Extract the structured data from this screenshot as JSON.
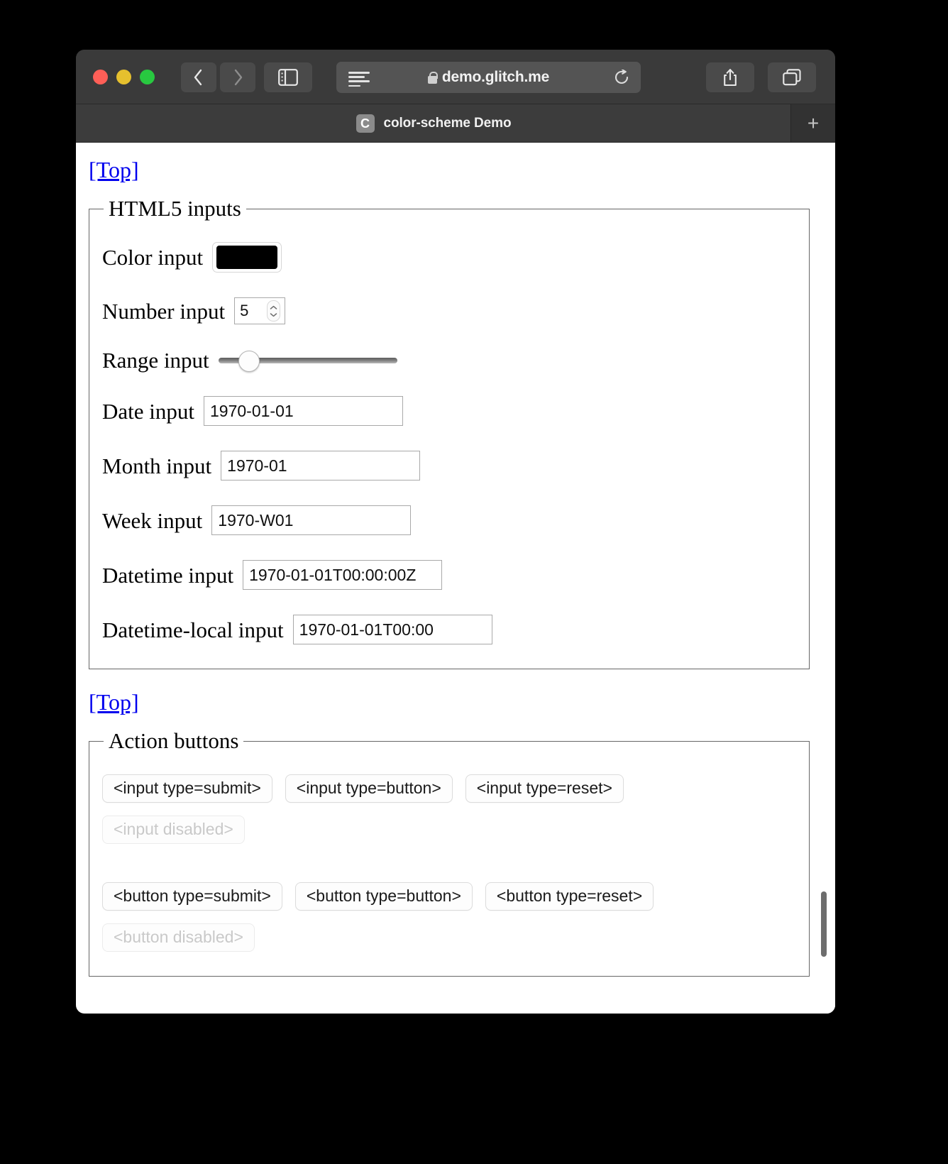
{
  "browser": {
    "window_controls": [
      "close",
      "minimize",
      "maximize"
    ],
    "back_label": "Back",
    "forward_label": "Forward",
    "sidebar_label": "Show sidebar",
    "reader_label": "Reader view",
    "share_label": "Share",
    "tabs_overview_label": "Tab overview",
    "reload_label": "Reload",
    "url": {
      "prefix": "",
      "text": "demo.glitch.me",
      "secure": true
    },
    "tab": {
      "favicon_letter": "C",
      "title": "color-scheme Demo"
    },
    "new_tab_label": "+",
    "chrome_colors": {
      "toolbar_bg": "#3a3a3a",
      "tabbar_bg": "#323232",
      "url_field_bg": "#545454",
      "close": "#ff5f57",
      "minimize": "#e6c02e",
      "maximize": "#28c840"
    }
  },
  "page": {
    "top_link_label": "[Top]",
    "link_color": "#0000ee",
    "sections": [
      {
        "legend": "HTML5 inputs",
        "fields": [
          {
            "label": "Color input",
            "kind": "color",
            "value": "#000000"
          },
          {
            "label": "Number input",
            "kind": "number",
            "value": "5"
          },
          {
            "label": "Range input",
            "kind": "range",
            "value": "15",
            "min": "0",
            "max": "100"
          },
          {
            "label": "Date input",
            "kind": "date",
            "value": "1970-01-01"
          },
          {
            "label": "Month input",
            "kind": "month",
            "value": "1970-01"
          },
          {
            "label": "Week input",
            "kind": "week",
            "value": "1970-W01"
          },
          {
            "label": "Datetime input",
            "kind": "datetime",
            "value": "1970-01-01T00:00:00Z"
          },
          {
            "label": "Datetime-local input",
            "kind": "datetime-local",
            "value": "1970-01-01T00:00"
          }
        ]
      },
      {
        "legend": "Action buttons",
        "input_buttons": [
          {
            "label": "<input type=submit>",
            "disabled": false
          },
          {
            "label": "<input type=button>",
            "disabled": false
          },
          {
            "label": "<input type=reset>",
            "disabled": false
          },
          {
            "label": "<input disabled>",
            "disabled": true
          }
        ],
        "button_elements": [
          {
            "label": "<button type=submit>",
            "disabled": false
          },
          {
            "label": "<button type=button>",
            "disabled": false
          },
          {
            "label": "<button type=reset>",
            "disabled": false
          },
          {
            "label": "<button disabled>",
            "disabled": true
          }
        ]
      }
    ]
  },
  "scrollbar": {
    "thumb_color": "#6d6d6d",
    "position_percent": 86
  }
}
